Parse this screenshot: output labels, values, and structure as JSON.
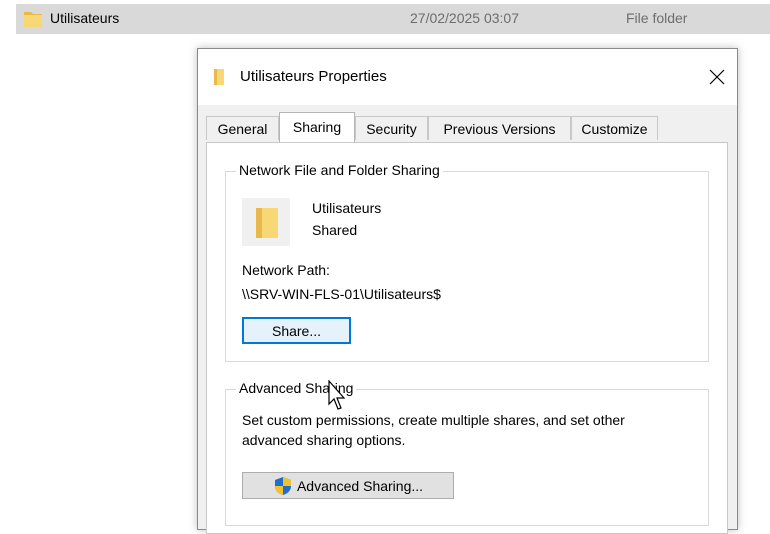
{
  "explorer": {
    "row": {
      "name": "Utilisateurs",
      "date_modified": "27/02/2025 03:07",
      "type": "File folder"
    }
  },
  "dialog": {
    "title": "Utilisateurs Properties",
    "close_icon": "close-icon",
    "tabs": [
      {
        "label": "General",
        "active": false
      },
      {
        "label": "Sharing",
        "active": true
      },
      {
        "label": "Security",
        "active": false
      },
      {
        "label": "Previous Versions",
        "active": false
      },
      {
        "label": "Customize",
        "active": false
      }
    ],
    "network_sharing": {
      "group_title": "Network File and Folder Sharing",
      "folder_name": "Utilisateurs",
      "status": "Shared",
      "network_path_label": "Network Path:",
      "network_path": "\\\\SRV-WIN-FLS-01\\Utilisateurs$",
      "share_button": "Share..."
    },
    "advanced_sharing": {
      "group_title": "Advanced Sharing",
      "description_line1": "Set custom permissions, create multiple shares, and set other",
      "description_line2": "advanced sharing options.",
      "button_label": "Advanced Sharing...",
      "button_icon": "uac-shield-icon"
    }
  },
  "colors": {
    "selection_bg": "#d9d9d9",
    "dialog_bg": "#f0f0f0",
    "default_button_border": "#0078d7",
    "folder_yellow": "#f8d775"
  }
}
